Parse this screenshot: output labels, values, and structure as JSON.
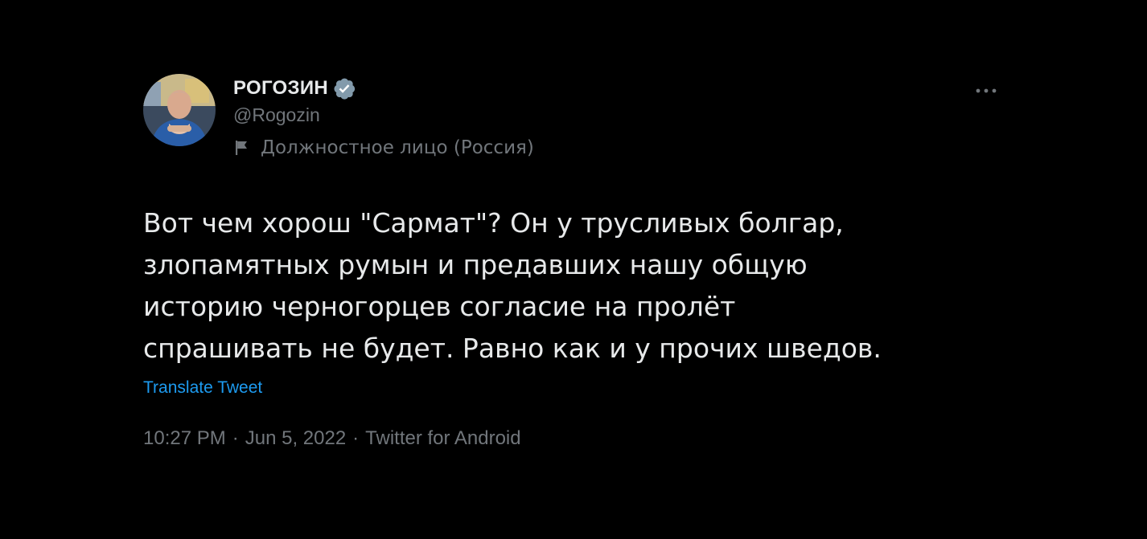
{
  "tweet": {
    "author": {
      "display_name": "РОГОЗИН",
      "handle": "@Rogozin",
      "label": "Должностное лицо (Россия)",
      "verified_icon": "verified-badge-icon",
      "label_icon": "flag-icon"
    },
    "more_icon": "more-horizontal-icon",
    "text_lines": [
      "Вот чем хорош \"Сармат\"? Он у трусливых болгар,",
      "злопамятных румын и предавших нашу общую",
      "историю черногорцев согласие на пролёт",
      "спрашивать не будет. Равно как и у прочих шведов."
    ],
    "translate_label": "Translate Tweet",
    "time": "10:27 PM",
    "date": "Jun 5, 2022",
    "source": "Twitter for Android",
    "separator": "·"
  },
  "colors": {
    "background": "#000000",
    "text_primary": "#e7e9ea",
    "text_secondary": "#71767b",
    "link": "#1d9bf0",
    "verified_badge": "#829aab"
  }
}
